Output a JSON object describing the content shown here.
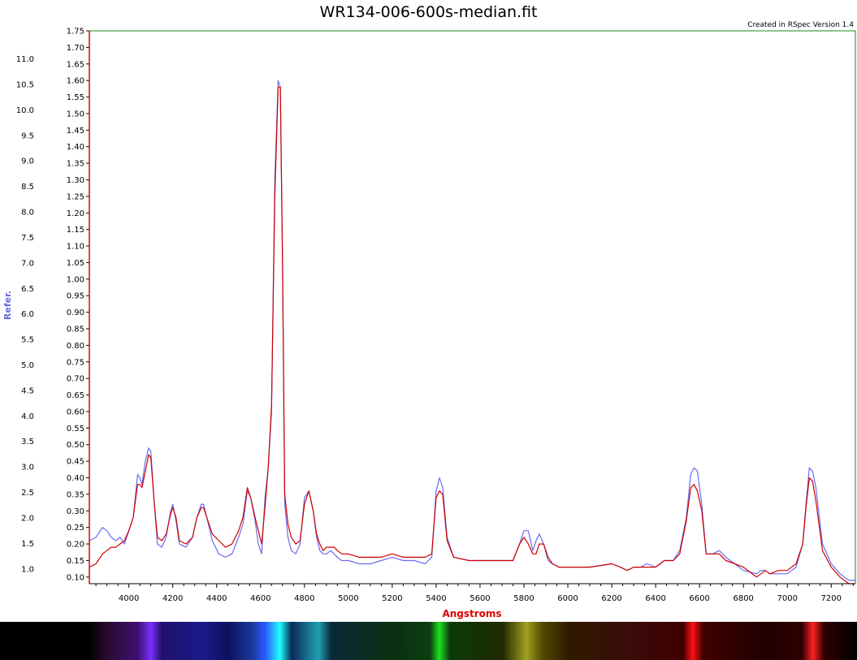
{
  "window": {
    "title": "WR134-006-600s-median.fit",
    "credit": "Created in RSpec Version 1.4"
  },
  "colors": {
    "reference_series": "#6b6bf0",
    "spectrum_series": "#d00000",
    "plot_border": "#1a8a1a",
    "left_axis_line": "#e00000"
  },
  "chart_data": {
    "type": "line",
    "title": "WR134-006-600s-median.fit",
    "xlabel": "Angstroms",
    "ylabel": "Refer.",
    "xlim": [
      3820,
      7310
    ],
    "ylim": [
      0.08,
      1.75
    ],
    "y2lim": [
      0.71,
      11.55
    ],
    "x_ticks": [
      4000,
      4200,
      4400,
      4600,
      4800,
      5000,
      5200,
      5400,
      5600,
      5800,
      6000,
      6200,
      6400,
      6600,
      6800,
      7000,
      7200
    ],
    "y_ticks": [
      "0.10",
      "0.15",
      "0.20",
      "0.25",
      "0.30",
      "0.35",
      "0.40",
      "0.45",
      "0.50",
      "0.55",
      "0.60",
      "0.65",
      "0.70",
      "0.75",
      "0.80",
      "0.85",
      "0.90",
      "0.95",
      "1.00",
      "1.05",
      "1.10",
      "1.15",
      "1.20",
      "1.25",
      "1.30",
      "1.35",
      "1.40",
      "1.45",
      "1.50",
      "1.55",
      "1.60",
      "1.65",
      "1.70",
      "1.75"
    ],
    "y2_ticks": [
      "1.0",
      "1.5",
      "2.0",
      "2.5",
      "3.0",
      "3.5",
      "4.0",
      "4.5",
      "5.0",
      "5.5",
      "6.0",
      "6.5",
      "7.0",
      "7.5",
      "8.0",
      "8.5",
      "9.0",
      "9.5",
      "10.0",
      "10.5",
      "11.0"
    ],
    "grid": false,
    "series": [
      {
        "color": "#6b6bf0",
        "x": [
          3820,
          3850,
          3880,
          3900,
          3920,
          3940,
          3960,
          3980,
          4000,
          4020,
          4040,
          4050,
          4060,
          4075,
          4090,
          4100,
          4115,
          4130,
          4150,
          4170,
          4190,
          4200,
          4215,
          4230,
          4260,
          4290,
          4310,
          4330,
          4340,
          4355,
          4380,
          4410,
          4440,
          4470,
          4500,
          4520,
          4540,
          4555,
          4575,
          4590,
          4605,
          4620,
          4635,
          4650,
          4665,
          4680,
          4690,
          4700,
          4710,
          4725,
          4740,
          4760,
          4780,
          4800,
          4820,
          4840,
          4855,
          4870,
          4885,
          4900,
          4920,
          4935,
          4950,
          4970,
          5000,
          5050,
          5100,
          5150,
          5200,
          5250,
          5300,
          5350,
          5380,
          5400,
          5415,
          5430,
          5450,
          5480,
          5550,
          5650,
          5750,
          5780,
          5800,
          5820,
          5840,
          5855,
          5870,
          5890,
          5910,
          5930,
          5960,
          6000,
          6100,
          6200,
          6240,
          6270,
          6300,
          6330,
          6360,
          6400,
          6440,
          6480,
          6510,
          6540,
          6560,
          6575,
          6590,
          6610,
          6630,
          6660,
          6690,
          6720,
          6760,
          6800,
          6860,
          6880,
          6900,
          6920,
          6960,
          7000,
          7040,
          7070,
          7085,
          7100,
          7115,
          7130,
          7160,
          7200,
          7240,
          7280,
          7310
        ],
        "y": [
          0.21,
          0.22,
          0.25,
          0.24,
          0.22,
          0.21,
          0.22,
          0.2,
          0.24,
          0.28,
          0.41,
          0.4,
          0.38,
          0.45,
          0.49,
          0.48,
          0.33,
          0.2,
          0.19,
          0.22,
          0.3,
          0.32,
          0.27,
          0.2,
          0.19,
          0.22,
          0.28,
          0.32,
          0.32,
          0.28,
          0.21,
          0.17,
          0.16,
          0.17,
          0.22,
          0.26,
          0.36,
          0.34,
          0.27,
          0.2,
          0.17,
          0.34,
          0.43,
          0.6,
          1.3,
          1.6,
          1.58,
          1.05,
          0.32,
          0.22,
          0.18,
          0.17,
          0.2,
          0.34,
          0.36,
          0.3,
          0.22,
          0.18,
          0.17,
          0.17,
          0.18,
          0.17,
          0.16,
          0.15,
          0.15,
          0.14,
          0.14,
          0.15,
          0.16,
          0.15,
          0.15,
          0.14,
          0.16,
          0.36,
          0.4,
          0.37,
          0.22,
          0.16,
          0.15,
          0.15,
          0.15,
          0.2,
          0.24,
          0.24,
          0.18,
          0.21,
          0.23,
          0.2,
          0.15,
          0.14,
          0.13,
          0.13,
          0.13,
          0.14,
          0.13,
          0.12,
          0.13,
          0.13,
          0.14,
          0.13,
          0.15,
          0.15,
          0.18,
          0.28,
          0.41,
          0.43,
          0.42,
          0.32,
          0.17,
          0.17,
          0.18,
          0.16,
          0.14,
          0.12,
          0.11,
          0.12,
          0.12,
          0.11,
          0.11,
          0.11,
          0.13,
          0.2,
          0.32,
          0.43,
          0.42,
          0.37,
          0.2,
          0.14,
          0.11,
          0.09,
          0.09
        ]
      },
      {
        "color": "#d00000",
        "x": [
          3820,
          3850,
          3880,
          3900,
          3920,
          3940,
          3960,
          3980,
          4000,
          4020,
          4040,
          4050,
          4060,
          4075,
          4090,
          4100,
          4115,
          4130,
          4150,
          4170,
          4190,
          4200,
          4215,
          4230,
          4260,
          4290,
          4310,
          4330,
          4340,
          4355,
          4380,
          4410,
          4440,
          4470,
          4500,
          4520,
          4540,
          4555,
          4575,
          4590,
          4605,
          4620,
          4635,
          4650,
          4665,
          4680,
          4690,
          4700,
          4710,
          4725,
          4740,
          4760,
          4780,
          4800,
          4820,
          4840,
          4855,
          4870,
          4885,
          4900,
          4920,
          4935,
          4950,
          4970,
          5000,
          5050,
          5100,
          5150,
          5200,
          5250,
          5300,
          5350,
          5380,
          5400,
          5415,
          5430,
          5450,
          5480,
          5550,
          5650,
          5750,
          5780,
          5800,
          5820,
          5840,
          5855,
          5870,
          5890,
          5910,
          5930,
          5960,
          6000,
          6100,
          6200,
          6240,
          6270,
          6300,
          6330,
          6360,
          6400,
          6440,
          6480,
          6510,
          6540,
          6560,
          6575,
          6590,
          6610,
          6630,
          6660,
          6690,
          6720,
          6760,
          6800,
          6860,
          6880,
          6900,
          6920,
          6960,
          7000,
          7040,
          7070,
          7085,
          7100,
          7115,
          7130,
          7160,
          7200,
          7240,
          7280,
          7310
        ],
        "y": [
          0.13,
          0.14,
          0.17,
          0.18,
          0.19,
          0.19,
          0.2,
          0.21,
          0.24,
          0.28,
          0.38,
          0.38,
          0.37,
          0.42,
          0.47,
          0.46,
          0.33,
          0.22,
          0.21,
          0.23,
          0.29,
          0.31,
          0.28,
          0.21,
          0.2,
          0.22,
          0.28,
          0.31,
          0.31,
          0.28,
          0.23,
          0.21,
          0.19,
          0.2,
          0.24,
          0.28,
          0.37,
          0.34,
          0.28,
          0.24,
          0.2,
          0.31,
          0.43,
          0.62,
          1.25,
          1.58,
          1.58,
          1.05,
          0.35,
          0.26,
          0.22,
          0.2,
          0.21,
          0.32,
          0.36,
          0.3,
          0.23,
          0.2,
          0.18,
          0.19,
          0.19,
          0.19,
          0.18,
          0.17,
          0.17,
          0.16,
          0.16,
          0.16,
          0.17,
          0.16,
          0.16,
          0.16,
          0.17,
          0.34,
          0.36,
          0.35,
          0.21,
          0.16,
          0.15,
          0.15,
          0.15,
          0.2,
          0.22,
          0.2,
          0.17,
          0.17,
          0.2,
          0.2,
          0.16,
          0.14,
          0.13,
          0.13,
          0.13,
          0.14,
          0.13,
          0.12,
          0.13,
          0.13,
          0.13,
          0.13,
          0.15,
          0.15,
          0.17,
          0.27,
          0.37,
          0.38,
          0.36,
          0.3,
          0.17,
          0.17,
          0.17,
          0.15,
          0.14,
          0.13,
          0.1,
          0.11,
          0.12,
          0.11,
          0.12,
          0.12,
          0.14,
          0.2,
          0.31,
          0.4,
          0.39,
          0.33,
          0.18,
          0.13,
          0.1,
          0.08,
          0.08
        ]
      }
    ],
    "spectrum_strip": {
      "stops": [
        {
          "x": 3820,
          "color": "#000000"
        },
        {
          "x": 3900,
          "color": "#2a0a30"
        },
        {
          "x": 4040,
          "color": "#3c1070"
        },
        {
          "x": 4100,
          "color": "#7a30ff"
        },
        {
          "x": 4150,
          "color": "#20106a"
        },
        {
          "x": 4340,
          "color": "#1a1a8a"
        },
        {
          "x": 4450,
          "color": "#101060"
        },
        {
          "x": 4560,
          "color": "#1a3a9a"
        },
        {
          "x": 4620,
          "color": "#2a5aff"
        },
        {
          "x": 4686,
          "color": "#20ffff"
        },
        {
          "x": 4740,
          "color": "#0a2a5a"
        },
        {
          "x": 4861,
          "color": "#20a0b0"
        },
        {
          "x": 4920,
          "color": "#0a2a3a"
        },
        {
          "x": 5200,
          "color": "#0a3010"
        },
        {
          "x": 5370,
          "color": "#0a4010"
        },
        {
          "x": 5411,
          "color": "#20e020"
        },
        {
          "x": 5460,
          "color": "#0a3a0a"
        },
        {
          "x": 5700,
          "color": "#202a00"
        },
        {
          "x": 5808,
          "color": "#a0a020"
        },
        {
          "x": 5880,
          "color": "#504a00"
        },
        {
          "x": 6000,
          "color": "#301a00"
        },
        {
          "x": 6300,
          "color": "#3a0a0a"
        },
        {
          "x": 6520,
          "color": "#400000"
        },
        {
          "x": 6563,
          "color": "#ff1010"
        },
        {
          "x": 6610,
          "color": "#400000"
        },
        {
          "x": 6900,
          "color": "#200000"
        },
        {
          "x": 7060,
          "color": "#300000"
        },
        {
          "x": 7110,
          "color": "#ff2020"
        },
        {
          "x": 7160,
          "color": "#300000"
        },
        {
          "x": 7310,
          "color": "#000000"
        }
      ]
    }
  }
}
